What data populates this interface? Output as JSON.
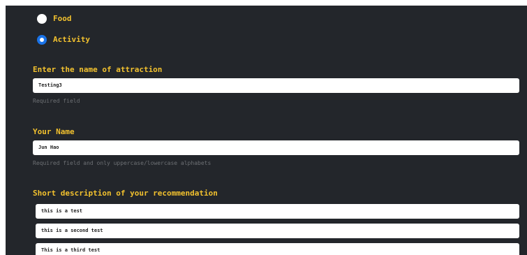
{
  "category": {
    "options": [
      {
        "label": "Food",
        "checked": false
      },
      {
        "label": "Activity",
        "checked": true
      }
    ]
  },
  "attraction": {
    "label": "Enter the name of attraction",
    "value": "Testing3",
    "help": "Required field"
  },
  "name": {
    "label": "Your Name",
    "value": "Jun Hao",
    "help": "Required field and only uppercase/lowercase alphabets"
  },
  "description": {
    "label": "Short description of your recommendation",
    "items": [
      "this is a test",
      "this is a second test",
      "This is a third test"
    ]
  },
  "colors": {
    "background": "#23262b",
    "accent": "#f2c12e",
    "radio_checked": "#1a73e8",
    "help_text": "#6d7074"
  }
}
